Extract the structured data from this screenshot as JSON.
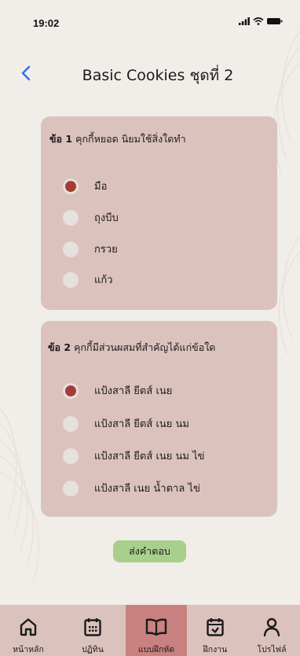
{
  "status_bar": {
    "time": "19:02"
  },
  "header": {
    "title": "Basic Cookies ชุดที่ 2"
  },
  "questions": [
    {
      "number": "ข้อ 1",
      "text": "คุกกี้หยอด นิยมใช้สิ่งใดทำ",
      "selected_index": 0,
      "options": [
        "มือ",
        "ถุงบีบ",
        "กรวย",
        "แก้ว"
      ]
    },
    {
      "number": "ข้อ 2",
      "text": "คุกกี้มีส่วนผสมที่สำคัญได้แก่ข้อใด",
      "selected_index": 0,
      "options": [
        "แป้งสาลี ยีตส์ เนย",
        "แป้งสาลี ยีตส์ เนย นม",
        "แป้งสาลี ยีตส์ เนย นม ไข่",
        "แป้งสาลี เนย น้ำตาล ไข่"
      ]
    }
  ],
  "submit_label": "ส่งคำตอบ",
  "bottom_nav": [
    {
      "label": "หน้าหลัก",
      "icon": "home-icon",
      "active": false
    },
    {
      "label": "ปฏิทิน",
      "icon": "calendar-icon",
      "active": false
    },
    {
      "label": "แบบฝึกหัด",
      "icon": "book-icon",
      "active": true
    },
    {
      "label": "ฝึกงาน",
      "icon": "calendar-check-icon",
      "active": false
    },
    {
      "label": "โปรไฟล์",
      "icon": "user-icon",
      "active": false
    }
  ],
  "colors": {
    "background": "#f1ede8",
    "card": "#dcc2bd",
    "radio_selected": "#a83a36",
    "submit_button": "#a9cf8c",
    "nav_active": "#c98180",
    "back_arrow": "#2f6ff0"
  }
}
